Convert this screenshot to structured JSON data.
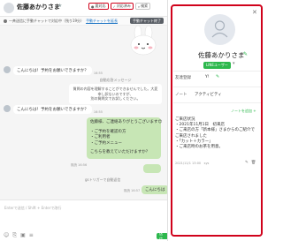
{
  "header": {
    "name": "佐藤あかりさま",
    "star": "★",
    "buttons": [
      {
        "icon": "chat-icon",
        "label": "要対応"
      },
      {
        "icon": "check-icon",
        "label": "対応済み"
      },
      {
        "icon": "search-icon",
        "label": "検索"
      }
    ]
  },
  "status_bar": {
    "text": "一斉送信に手動チャットで対応中（残り19分）",
    "link": "手動チャットを延長",
    "manual_button": "手動チャット終了"
  },
  "messages": [
    {
      "side": "left",
      "text": "こんにちは！予約をお願いできますか？",
      "time": "16:55"
    },
    {
      "side": "auto",
      "label": "自動応答メッセージ",
      "body_lines": [
        "質問の内容を理解することができませんでした。大変申し訳ないのですが、",
        "別の質問文でお試しください。"
      ]
    },
    {
      "side": "left",
      "text": "こんにちは！予約をお願いできますか？",
      "time": "16:55"
    }
  ],
  "outgoing": {
    "lines": [
      "佐藤様、ご連絡ありがとうございます😊",
      "",
      "・ご予約を確認の方",
      "・ご利用者",
      "・ご予約メニュー",
      "",
      "こちらを教えていただけますか？"
    ],
    "meta": "既読 16:56",
    "auto_tag": "gsトリガーで自動返信",
    "short_reply": "こんにちは",
    "short_meta": "既読 16:57"
  },
  "input": {
    "placeholder": "Enterで送信 / Shift + Enterで改行",
    "send_label": "送信"
  },
  "profile": {
    "name": "佐藤あかりさま",
    "badge": "LINEユーザー",
    "fields": [
      {
        "label": "友達登録",
        "value": "Y!"
      },
      {
        "label": "ノート",
        "value": "アクティビティ"
      }
    ],
    "add_note": "ノートを追加 +",
    "note_lines": [
      "ご来店状況",
      "・2021年11月1日　初来店",
      "・ご来店の方「新本様」さまからのご紹介で",
      "ご来店されました",
      "・「カット＋カラー」",
      "・ご来店時のお茶を用意。"
    ],
    "note_time": "2021/11/1 13:00　sys",
    "colors": {
      "accent": "#2db84d",
      "highlight": "#d0021b"
    }
  }
}
